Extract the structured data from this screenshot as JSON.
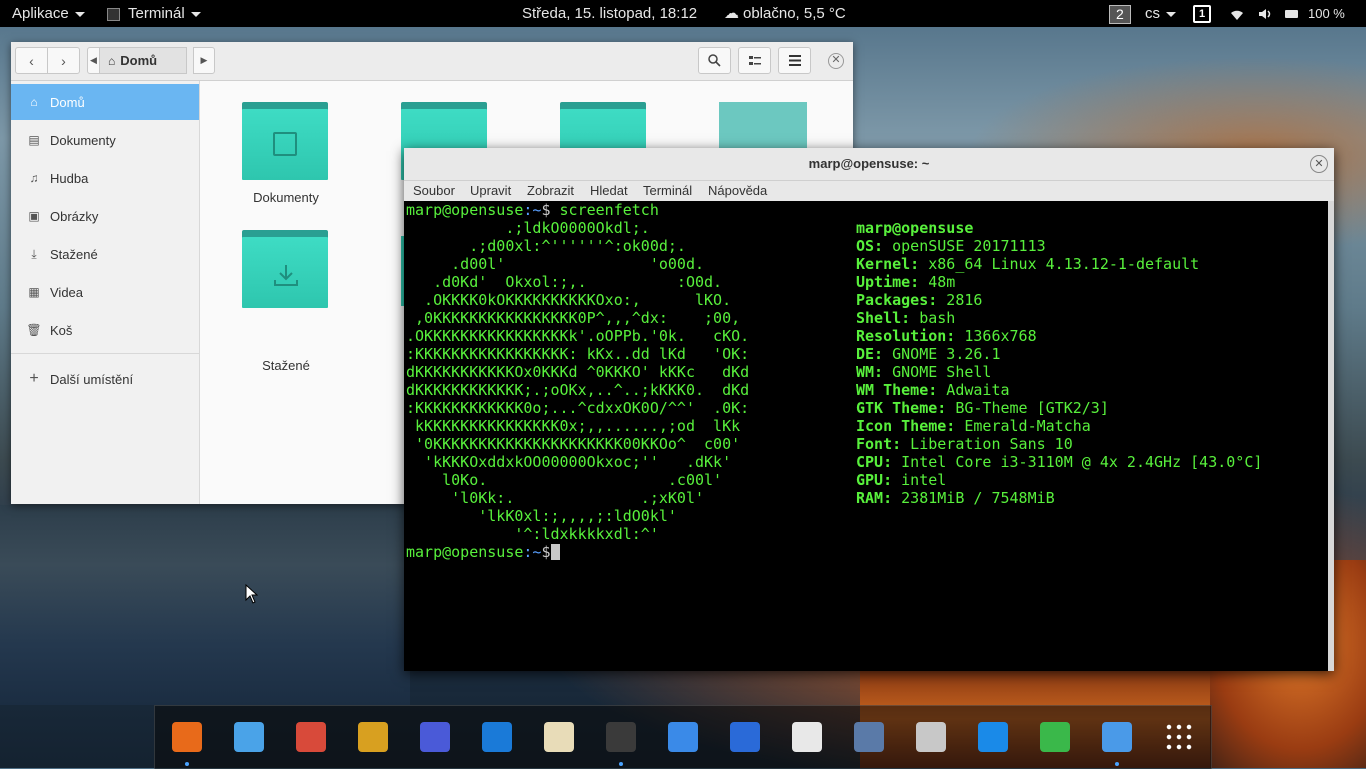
{
  "topbar": {
    "apps_label": "Aplikace",
    "terminal_label": "Terminál",
    "datetime": "Středa, 15. listopad, 18:12",
    "weather": "oblačno, 5,5 °C",
    "workspace": "2",
    "language": "cs",
    "workspace_indicator": "1",
    "battery": "100 %"
  },
  "file_manager": {
    "path_label": "Domů",
    "sidebar": [
      {
        "label": "Domů",
        "icon": "home-icon",
        "active": true
      },
      {
        "label": "Dokumenty",
        "icon": "document-icon"
      },
      {
        "label": "Hudba",
        "icon": "music-icon"
      },
      {
        "label": "Obrázky",
        "icon": "image-icon"
      },
      {
        "label": "Stažené",
        "icon": "download-icon"
      },
      {
        "label": "Videa",
        "icon": "film-icon"
      },
      {
        "label": "Koš",
        "icon": "trash-icon"
      }
    ],
    "other_locations": "Další umístění",
    "folders": [
      {
        "label": "Dokumenty"
      },
      {
        "label": "Stažené"
      }
    ]
  },
  "terminal": {
    "title": "marp@opensuse: ~",
    "menu": [
      "Soubor",
      "Upravit",
      "Zobrazit",
      "Hledat",
      "Terminál",
      "Nápověda"
    ],
    "prompt_user": "marp@opensuse",
    "prompt_path": ":~",
    "prompt_symbol": "$",
    "command": " screenfetch",
    "logo": [
      "           .;ldkO0000Okdl;.",
      "       .;d00xl:^''''''^:ok00d;.",
      "     .d00l'                'o00d.",
      "   .d0Kd'  Okxol:;,.          :O0d.",
      "  .OKKKK0kOKKKKKKKKKKOxo:,      lKO.",
      " ,0KKKKKKKKKKKKKKKK0P^,,,^dx:    ;00,",
      ".OKKKKKKKKKKKKKKKKk'.oOPPb.'0k.   cKO.",
      ":KKKKKKKKKKKKKKKKK: kKx..dd lKd   'OK:",
      "dKKKKKKKKKKKOx0KKKd ^0KKKO' kKKc   dKd",
      "dKKKKKKKKKKKK;.;oOKx,..^..;kKKK0.  dKd",
      ":KKKKKKKKKKKK0o;...^cdxxOK0O/^^'  .0K:",
      " kKKKKKKKKKKKKKKK0x;,,......,;od  lKk",
      " '0KKKKKKKKKKKKKKKKKKKKK00KKOo^  c00'",
      "  'kKKKOxddxkOO00000Okxoc;''   .dKk'",
      "    l0Ko.                    .c00l'",
      "     'l0Kk:.              .;xK0l'",
      "        'lkK0xl:;,,,,;:ldO0kl'",
      "            '^:ldxkkkkxdl:^'"
    ],
    "info_user": "marp@opensuse",
    "info": [
      {
        "key": "OS:",
        "value": " openSUSE 20171113"
      },
      {
        "key": "Kernel:",
        "value": " x86_64 Linux 4.13.12-1-default"
      },
      {
        "key": "Uptime:",
        "value": " 48m"
      },
      {
        "key": "Packages:",
        "value": " 2816"
      },
      {
        "key": "Shell:",
        "value": " bash"
      },
      {
        "key": "Resolution:",
        "value": " 1366x768"
      },
      {
        "key": "DE:",
        "value": " GNOME 3.26.1"
      },
      {
        "key": "WM:",
        "value": " GNOME Shell"
      },
      {
        "key": "WM Theme:",
        "value": " Adwaita"
      },
      {
        "key": "GTK Theme:",
        "value": " BG-Theme [GTK2/3]"
      },
      {
        "key": "Icon Theme:",
        "value": " Emerald-Matcha"
      },
      {
        "key": "Font:",
        "value": " Liberation Sans 10"
      },
      {
        "key": "CPU:",
        "value": " Intel Core i3-3110M @ 4x 2.4GHz [43.0°C]"
      },
      {
        "key": "GPU:",
        "value": " intel"
      },
      {
        "key": "RAM:",
        "value": " 2381MiB / 7548MiB"
      }
    ]
  },
  "dock": [
    {
      "name": "firefox-icon",
      "color": "#e86a1a",
      "running": true
    },
    {
      "name": "mail-icon",
      "color": "#4aa3e8"
    },
    {
      "name": "color-palette-icon",
      "color": "#d84a3a"
    },
    {
      "name": "music-player-icon",
      "color": "#d8a020"
    },
    {
      "name": "night-sky-icon",
      "color": "#4a5ad8"
    },
    {
      "name": "writer-icon",
      "color": "#1a7ad8"
    },
    {
      "name": "text-editor-icon",
      "color": "#e8dcb8"
    },
    {
      "name": "terminal-icon",
      "color": "#3a3a3a",
      "running": true
    },
    {
      "name": "settings-toggle-icon",
      "color": "#3a8ae8"
    },
    {
      "name": "tweaks-toggle-icon",
      "color": "#2a6ad8"
    },
    {
      "name": "downloader-icon",
      "color": "#e8e8e8"
    },
    {
      "name": "calculator-icon",
      "color": "#5a7aa8"
    },
    {
      "name": "webcam-icon",
      "color": "#c8c8c8"
    },
    {
      "name": "tasks-icon",
      "color": "#1a8ae8"
    },
    {
      "name": "maps-icon",
      "color": "#3ab84a"
    },
    {
      "name": "files-icon",
      "color": "#4a9ae8",
      "running": true
    },
    {
      "name": "app-grid-icon",
      "color": "#ffffff"
    }
  ]
}
